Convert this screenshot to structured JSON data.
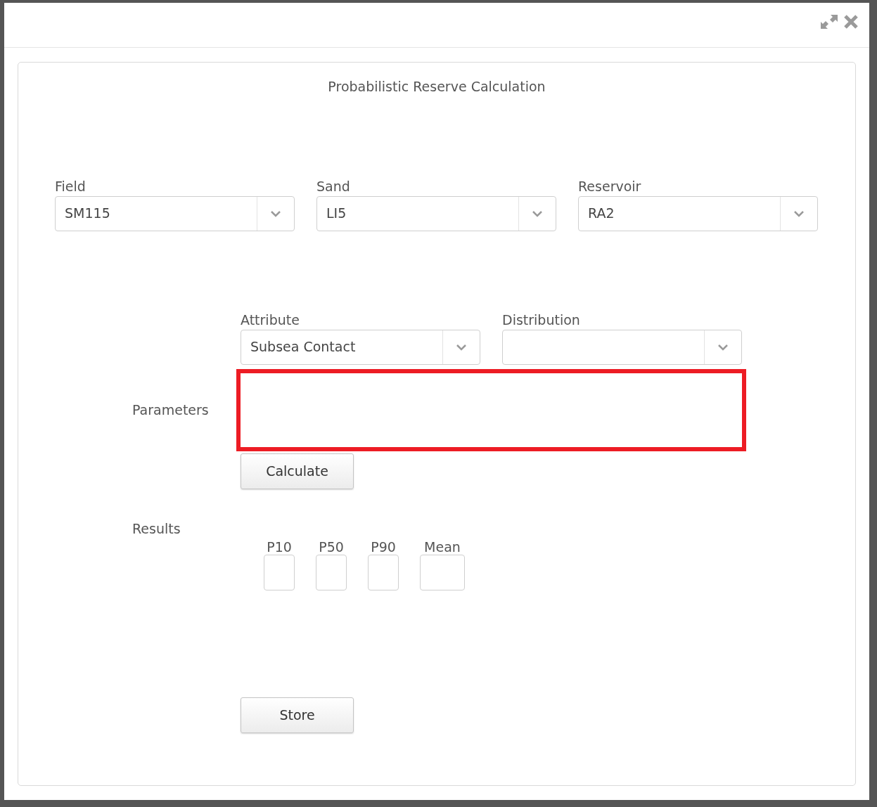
{
  "window": {
    "controls": [
      {
        "kind": "maximize"
      },
      {
        "kind": "close"
      }
    ]
  },
  "title": "Probabilistic Reserve Calculation",
  "location_selects": [
    {
      "label": "Field",
      "value": "SM115"
    },
    {
      "label": "Sand",
      "value": "LI5"
    },
    {
      "label": "Reservoir",
      "value": "RA2"
    }
  ],
  "attribute_selects": [
    {
      "label": "Attribute",
      "value": "Subsea Contact"
    },
    {
      "label": "Distribution"
    }
  ],
  "parameters": {
    "label": "Parameters",
    "error": true
  },
  "calculate_button": "Calculate",
  "results": {
    "label": "Results",
    "fields": [
      {
        "label": "P10",
        "wide": false
      },
      {
        "label": "P50",
        "wide": false
      },
      {
        "label": "P90",
        "wide": false
      },
      {
        "label": "Mean",
        "wide": true
      }
    ]
  },
  "store_button": "Store"
}
